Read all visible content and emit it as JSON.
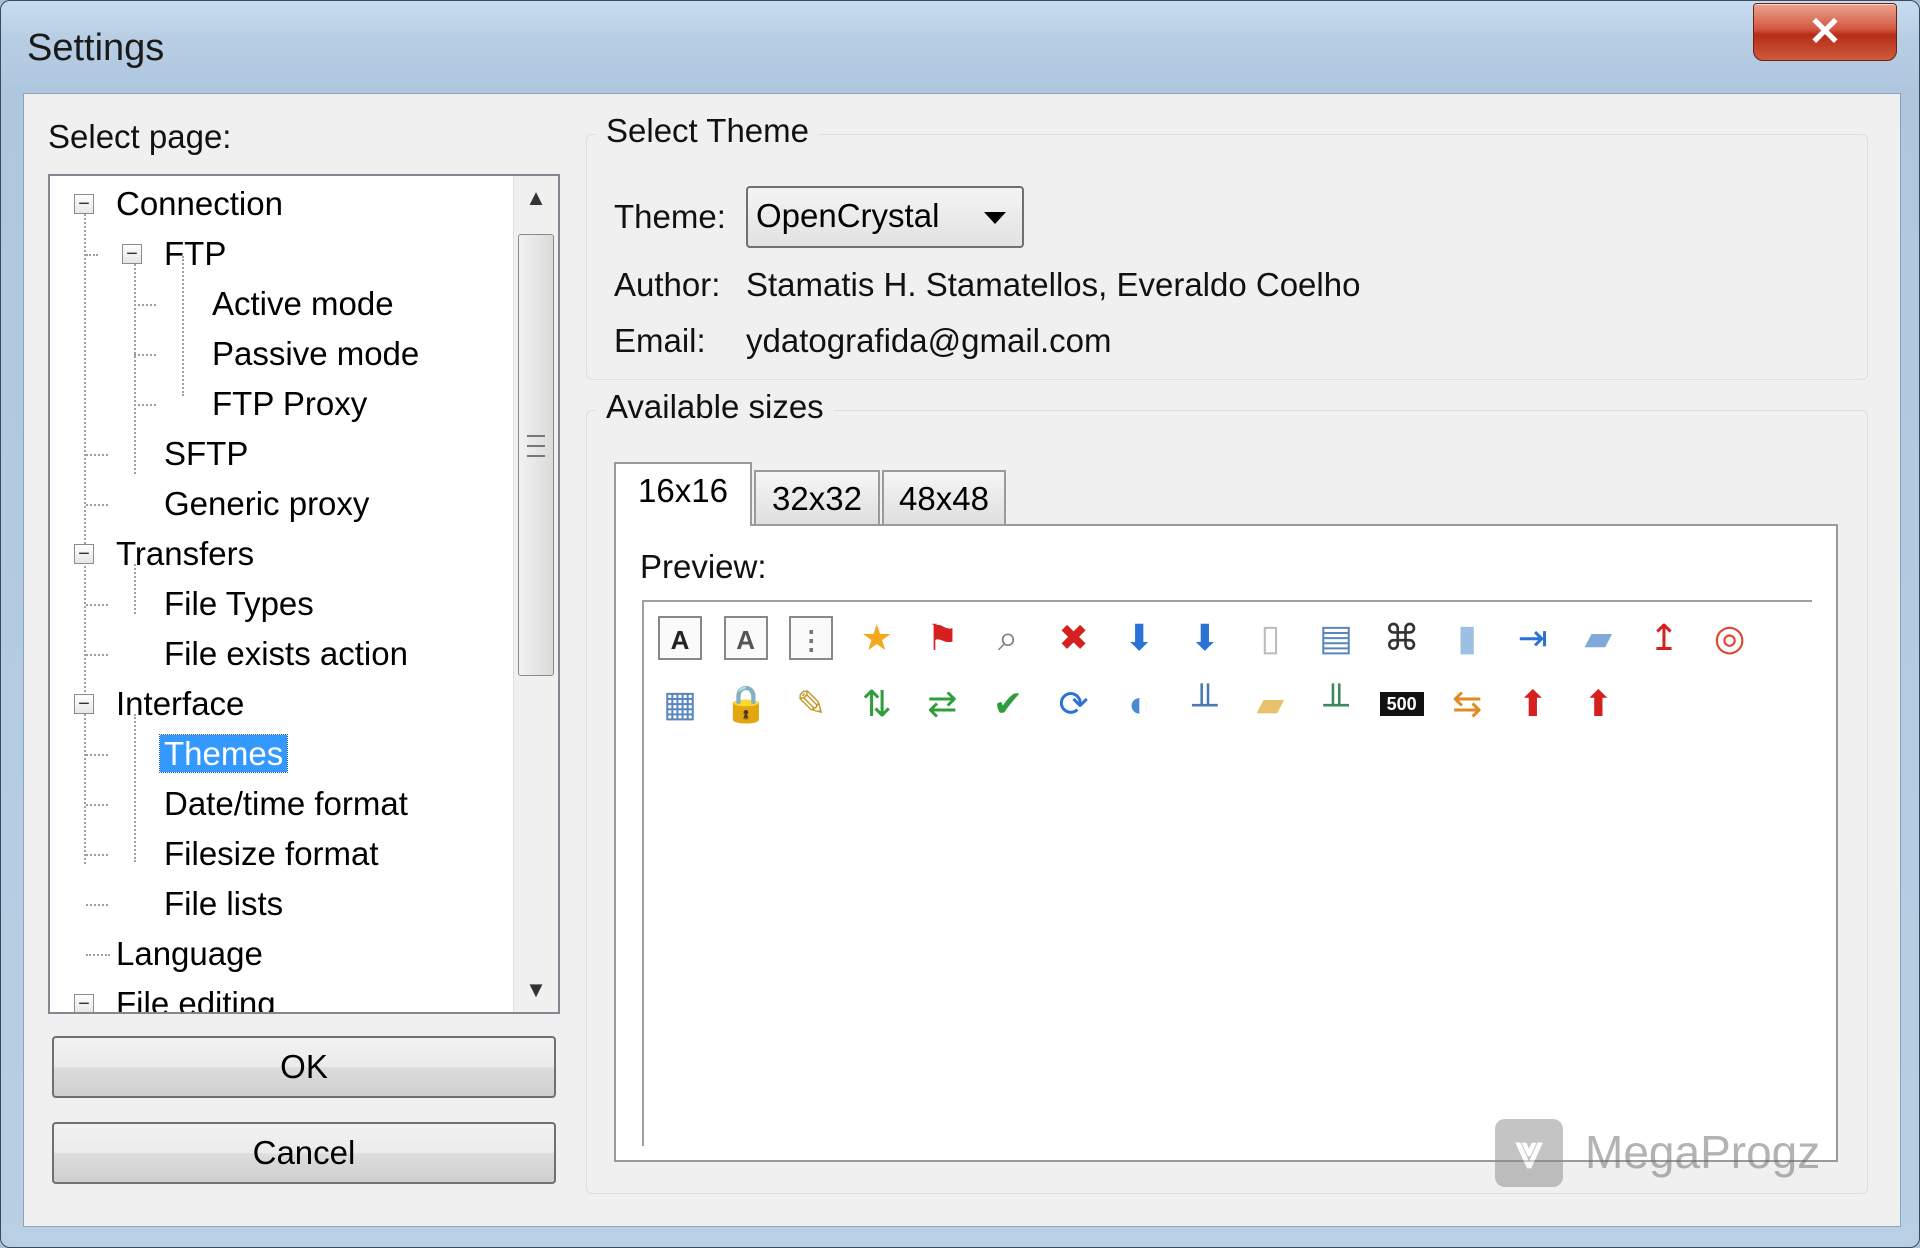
{
  "window": {
    "title": "Settings",
    "close_glyph": "✕"
  },
  "select_page_label": "Select page:",
  "tree": {
    "nodes": [
      {
        "label": "Connection",
        "expander": "−"
      },
      {
        "label": "FTP",
        "expander": "−"
      },
      {
        "label": "Active mode"
      },
      {
        "label": "Passive mode"
      },
      {
        "label": "FTP Proxy"
      },
      {
        "label": "SFTP"
      },
      {
        "label": "Generic proxy"
      },
      {
        "label": "Transfers",
        "expander": "−"
      },
      {
        "label": "File Types"
      },
      {
        "label": "File exists action"
      },
      {
        "label": "Interface",
        "expander": "−"
      },
      {
        "label": "Themes",
        "selected": true
      },
      {
        "label": "Date/time format"
      },
      {
        "label": "Filesize format"
      },
      {
        "label": "File lists"
      },
      {
        "label": "Language"
      },
      {
        "label": "File editing",
        "expander": "−"
      }
    ],
    "scroll_up_glyph": "▲",
    "scroll_down_glyph": "▼"
  },
  "buttons": {
    "ok": "OK",
    "cancel": "Cancel"
  },
  "select_theme": {
    "group_title": "Select Theme",
    "theme_label": "Theme:",
    "theme_value": "OpenCrystal",
    "author_label": "Author:",
    "author_value": "Stamatis H. Stamatellos, Everaldo Coelho",
    "email_label": "Email:",
    "email_value": "ydatografida@gmail.com"
  },
  "available_sizes": {
    "group_title": "Available sizes",
    "tabs": [
      "16x16",
      "32x32",
      "48x48"
    ],
    "active_tab": "16x16",
    "preview_label": "Preview:"
  },
  "preview_icons": {
    "row1": [
      {
        "name": "font-a-icon",
        "glyph": "A",
        "color": "#222222",
        "box": true
      },
      {
        "name": "font-italic-icon",
        "glyph": "A",
        "color": "#555555",
        "box": true
      },
      {
        "name": "text-select-icon",
        "glyph": "⋮",
        "color": "#777777",
        "box": true
      },
      {
        "name": "star-icon",
        "glyph": "★",
        "color": "#f2a91e"
      },
      {
        "name": "flag-error-icon",
        "glyph": "⚑",
        "color": "#d62020"
      },
      {
        "name": "magnifier-icon",
        "glyph": "⌕",
        "color": "#7a7f8a"
      },
      {
        "name": "disconnect-icon",
        "glyph": "✖",
        "color": "#d62020"
      },
      {
        "name": "download-arrow-icon",
        "glyph": "⬇",
        "color": "#2a72d6"
      },
      {
        "name": "download-add-icon",
        "glyph": "⬇",
        "color": "#2a72d6"
      },
      {
        "name": "blank-page-icon",
        "glyph": "▯",
        "color": "#bbbbbb"
      },
      {
        "name": "list-view-icon",
        "glyph": "▤",
        "color": "#5a86c0"
      },
      {
        "name": "binoculars-icon",
        "glyph": "⌘",
        "color": "#333333"
      },
      {
        "name": "server-icon",
        "glyph": "▮",
        "color": "#9ebfe4"
      },
      {
        "name": "server-import-icon",
        "glyph": "⇥",
        "color": "#2a72d6"
      },
      {
        "name": "folder-blue-icon",
        "glyph": "▰",
        "color": "#7fa9da"
      },
      {
        "name": "upload-server-icon",
        "glyph": "↥",
        "color": "#d62020"
      },
      {
        "name": "lifebuoy-icon",
        "glyph": "◎",
        "color": "#e2452f"
      }
    ],
    "row2": [
      {
        "name": "details-view-icon",
        "glyph": "▦",
        "color": "#5a86c0"
      },
      {
        "name": "lock-icon",
        "glyph": "🔒",
        "color": "#8a8a8a"
      },
      {
        "name": "edit-document-icon",
        "glyph": "✎",
        "color": "#c49a2c"
      },
      {
        "name": "transfer-updown-icon",
        "glyph": "⇅",
        "color": "#2e9e3a"
      },
      {
        "name": "sync-arrows-icon",
        "glyph": "⇄",
        "color": "#2e9e3a"
      },
      {
        "name": "check-icon",
        "glyph": "✔",
        "color": "#2e9e3a"
      },
      {
        "name": "refresh-icon",
        "glyph": "⟳",
        "color": "#2a72d6"
      },
      {
        "name": "globe-icon",
        "glyph": "◐",
        "color": "#4a8ad0"
      },
      {
        "name": "network-server-icon",
        "glyph": "╨",
        "color": "#4a7ab0"
      },
      {
        "name": "folder-icon",
        "glyph": "▰",
        "color": "#e7c26a"
      },
      {
        "name": "remote-server-icon",
        "glyph": "╨",
        "color": "#3a8a5a"
      },
      {
        "name": "speed-limit-icon",
        "glyph": "500",
        "color": "#111111"
      },
      {
        "name": "reconnect-icon",
        "glyph": "⇆",
        "color": "#e08a20"
      },
      {
        "name": "upload-arrow-icon",
        "glyph": "⬆",
        "color": "#d62020"
      },
      {
        "name": "upload-add-icon",
        "glyph": "⬆",
        "color": "#d62020"
      }
    ]
  },
  "watermark": {
    "text": "MegaProgz",
    "logo_glyph": "⩔"
  }
}
